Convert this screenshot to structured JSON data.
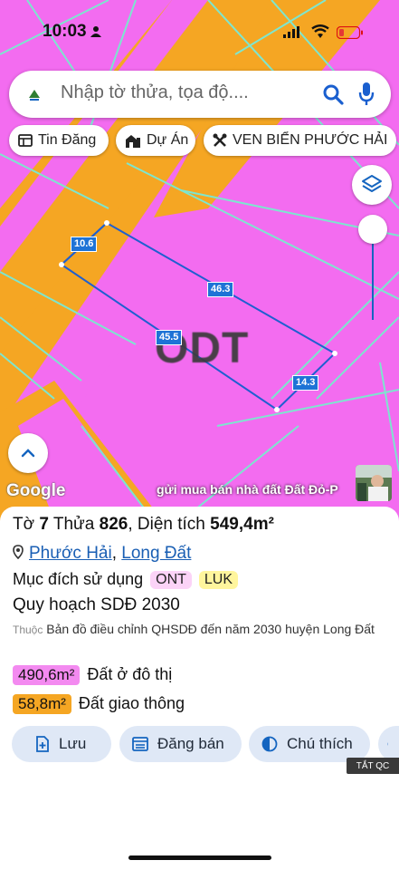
{
  "status_bar": {
    "time": "10:03"
  },
  "search": {
    "placeholder": "Nhập tờ thửa, tọa độ...."
  },
  "chips": [
    {
      "label": "Tin Đăng",
      "icon": "newspaper-icon"
    },
    {
      "label": "Dự Án",
      "icon": "buildings-icon"
    },
    {
      "label": "VEN BIỂN PHƯỚC HẢI",
      "icon": "tools-icon"
    }
  ],
  "map": {
    "zone_label": "ODT",
    "dimensions": [
      "10.6",
      "46.3",
      "45.5",
      "14.3"
    ],
    "attribution": "Google",
    "banner": "gửi mua bán nhà đất Đất Đỏ-P",
    "colors": {
      "residential": "#f36cf0",
      "road": "#f5a623",
      "parcel_border": "#1e5fd0",
      "grid": "#7de6cf"
    }
  },
  "parcel": {
    "sheet_label": "Tờ",
    "sheet_no": "7",
    "lot_label": "Thửa",
    "lot_no": "826",
    "area_label": "Diện tích",
    "area": "549,4m²",
    "ward": "Phước Hải",
    "district": "Long Đất",
    "usage_label": "Mục đích sử dụng",
    "usage_codes": [
      "ONT",
      "LUK"
    ],
    "plan_title": "Quy hoạch SDĐ 2030",
    "source_prefix": "Thuộc",
    "source": "Bản đồ điều chỉnh QHSDĐ đến năm 2030 huyện Long Đất",
    "areas": [
      {
        "value": "490,6m²",
        "label": "Đất ở đô thị",
        "color": "#f38af0"
      },
      {
        "value": "58,8m²",
        "label": "Đất giao thông",
        "color": "#f5a623"
      }
    ]
  },
  "actions": [
    {
      "label": "Lưu",
      "icon": "bookmark-add-icon"
    },
    {
      "label": "Đăng bán",
      "icon": "listing-icon"
    },
    {
      "label": "Chú thích",
      "icon": "contrast-icon"
    }
  ],
  "ads_label": "TẮT QC"
}
